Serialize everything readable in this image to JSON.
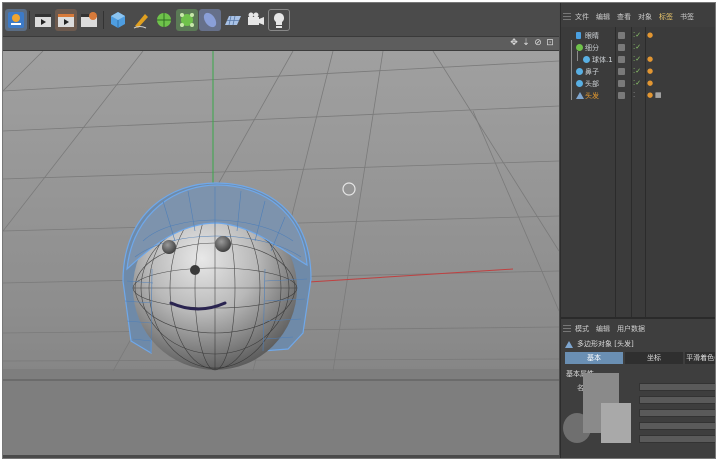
{
  "toolbar": {
    "buttons": [
      {
        "name": "undo-icon",
        "color": "#3c7ac7"
      },
      {
        "name": "render-view-icon",
        "color": "#d0d0d0"
      },
      {
        "name": "render-picture-viewer-icon",
        "color": "#d77a3a"
      },
      {
        "name": "render-settings-icon",
        "color": "#d0d0d0"
      },
      {
        "name": "cube-icon",
        "color": "#4e9de0"
      },
      {
        "name": "pen-icon",
        "color": "#e0a020"
      },
      {
        "name": "subdivision-icon",
        "color": "#6fc24b"
      },
      {
        "name": "array-icon",
        "color": "#6fc24b"
      },
      {
        "name": "deformer-icon",
        "color": "#8a9fd8"
      },
      {
        "name": "floor-icon",
        "color": "#a9c2e6"
      },
      {
        "name": "camera-icon",
        "color": "#e6e6e6"
      },
      {
        "name": "light-icon",
        "color": "#e6e6e6"
      }
    ]
  },
  "viewport": {
    "nav_icons": [
      "✥",
      "⇣",
      "⊘",
      "⊡"
    ]
  },
  "object_manager": {
    "tabs": [
      "文件",
      "编辑",
      "查看",
      "对象",
      "标签",
      "书签"
    ],
    "active_tab_index": 4,
    "objects": [
      {
        "label": "眼睛",
        "depth": 0,
        "icon_color": "#4aa0e0",
        "selected": false
      },
      {
        "label": "细分",
        "depth": 0,
        "icon_color": "#59b0e4",
        "selected": false
      },
      {
        "label": "球体.1",
        "depth": 1,
        "icon_color": "#59b0e4",
        "selected": false
      },
      {
        "label": "鼻子",
        "depth": 0,
        "icon_color": "#59b0e4",
        "selected": false
      },
      {
        "label": "头部",
        "depth": 0,
        "icon_color": "#59b0e4",
        "selected": false
      },
      {
        "label": "头发",
        "depth": 0,
        "icon_color": "#7ea6d0",
        "selected": true
      }
    ]
  },
  "attribute_manager": {
    "tabs": [
      "模式",
      "编辑",
      "用户数据"
    ],
    "title": "多边形对象 [头发]",
    "subtabs": [
      "基本",
      "坐标",
      "平滑着色("
    ],
    "active_subtab_index": 0,
    "section_title": "基本属性",
    "field_label": "名称"
  },
  "colors": {
    "accent_blue": "#6a8fb3",
    "selected_orange": "#e89b2e",
    "tag_yellow": "#e7c46b"
  }
}
